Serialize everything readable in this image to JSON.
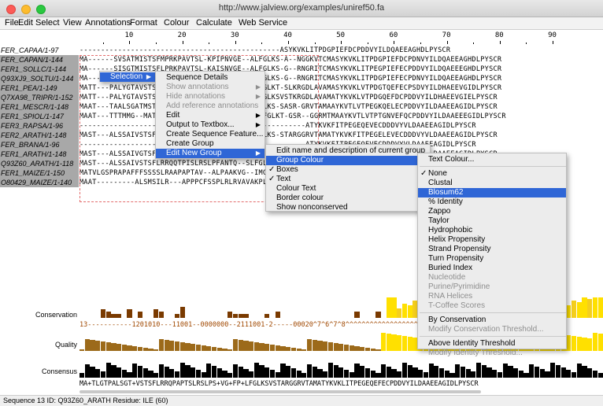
{
  "window": {
    "title": "http://www.jalview.org/examples/uniref50.fa"
  },
  "menubar": [
    "File",
    "Edit",
    "Select",
    "View",
    "Annotations",
    "Format",
    "Colour",
    "Calculate",
    "Web Service"
  ],
  "ruler": [
    "10",
    "20",
    "30",
    "40",
    "50",
    "60",
    "70",
    "80",
    "90"
  ],
  "sequences": [
    {
      "name": "FER_CAPAA/1-97",
      "seq": "-----------------------------------------------ASYKVKLITPDGPIEFDCPDDVYILDQAEEAGHDLPYSCR"
    },
    {
      "name": "FER_CAPAN/1-144",
      "seq": "MA------SVSATMISTSFMPRKPAVTSL-KPIPNVGE--ALFGLKS-A--NGGKVTCMASYKVKLITPDGPIEFDCPDNVYILDQAEEAGHDLPYSCR"
    },
    {
      "name": "FER1_SOLLC/1-144",
      "seq": "MA------SISGTMISTSFLPRKPAVTSL-KAISNVGE--ALFGLKS-G--RNGRITCMASYKVKLITPEGPIEFECPDDVYILDQAEEEGHDLPYSCR"
    },
    {
      "name": "Q93XJ9_SOLTU/1-144",
      "seq": "MA------SISGTMISTSFLPRKPVVTSL-KAISNVGE--ALFGLKS-G--RNGRITCMASYKVKLITPDGPIEFECPDNVYILDQAEEAGHDLPYSCR"
    },
    {
      "name": "FER1_PEA/1-149",
      "seq": "MATT---PALYGTAVSTSFLRTQPMPMSV-TTTKAFSN--GFLGLKT-SLKRGDLAVAMASYKVKLVTPDGTQEFECPSDVYILDHAEEVGIDLPYSCR"
    },
    {
      "name": "Q7XA98_TRIPR/1-152",
      "seq": "MATT---PALYGTAVSTSFMRRQPVPMSV-ATTTTTKAFPSGFGLKSVSTKRGDLAVAMATYKVKLVTPDGQEFDCPDDVYILDHAEEVGIELPYSCR"
    },
    {
      "name": "FER1_MESCR/1-148",
      "seq": "MAAT---TAALSGATMSTAFAPKTPPMTAALPTNVGR--ALFGLKS-SASR-GRVTAMAAYKVTLVTPEGKQELECPDDVYILDAAEEAGIDLPYSCR"
    },
    {
      "name": "FER1_SPIOL/1-147",
      "seq": "MAAT---TTTMMG--MATTFVPKPQAPPMMAALPSNTGR--SLFGLKT-GSR--GGRMTMAAYKVTLVTPTGNVEFQCPDDVYILDAAEEEGIDLPYSCR"
    },
    {
      "name": "FER3_RAPSA/1-96",
      "seq": "-----------------------------------------------------ATYKVKFITPEGEQEVECDDDVYVLDAAEEAGIDLPYSCR"
    },
    {
      "name": "FER2_ARATH/1-148",
      "seq": "MAST---ALSSAIVSTSFLRRQQTPISLRSLPFANTQ--SLFGLKS-STARGGRVTAMATYKVKFITPEGELEVECDDDVYVLDAAEEAGIDLPYSCR"
    },
    {
      "name": "FER_BRANA/1-96",
      "seq": "-----------------------------------------------------ATYKVKFITPEGEQEVECDDDVYVLDAAEEAGIDLPYSCR"
    },
    {
      "name": "FER1_ARATH/1-148",
      "seq": "MAST---ALSSAIVGTSFIRRSPAPISLRSLPSANTQ--SLFGLKS-GTARGGRVTAMATYKVKFITPEGELEVECDDDVYVLDAAEEAGIDLPYSCR"
    },
    {
      "name": "Q93Z60_ARATH/1-118",
      "seq": "MAST---ALSSAIVSTSFLRRQQTPISLRSLPFANTQ--SLFGLKS-STARGGRVTAMATYKVKFITPEGELEVECDDDVYVLDAAEEAGIDLPYSCR"
    },
    {
      "name": "FER1_MAIZE/1-150",
      "seq": "MATVLGSPRAPAFFFSSSSLRAAPAPTAV--ALPAAKVG--IMGRSA-SSRRRLRAQATYNVKLITPEGEVELQVPDDVYILDQAEEDGIDLPYSCR"
    },
    {
      "name": "O80429_MAIZE/1-140",
      "seq": "MAAT---------ALSMSILR---APPPCFSSPLRLRVAVAKPLAA--PMRRQLLRAQATYNVKLITPEGEVELQVPDDVYILDFAEEEGIDLPFSCR"
    }
  ],
  "annotations": {
    "conservation_label": "Conservation",
    "quality_label": "Quality",
    "consensus_label": "Consensus",
    "conservation_text": "13-----------1201010---11001--0000000--2111001-2-----00020^7^6^7^8^^^^^^^^^^^^^^^^^^^^^^^^^^9^9^^^",
    "consensus_text": "MA+TLGTPALSGT+VSTSFLRRQPAPTSLRSLPS+VG+FP+LFGLKSVSTARGGRVTAMATYKVKLITPEGEQEFECPDDVYILDAAEEAGIDLPYSCR"
  },
  "status": "Sequence 13 ID: Q93Z60_ARATH Residue: ILE (60)",
  "menus": {
    "selection_label": "Selection",
    "popup1": [
      {
        "label": "Sequence Details"
      },
      {
        "label": "Show annotations",
        "disabled": true,
        "sub": true
      },
      {
        "label": "Hide annotations",
        "disabled": true,
        "sub": true
      },
      {
        "label": "Add reference annotations",
        "disabled": true
      },
      {
        "label": "Edit",
        "sub": true
      },
      {
        "label": "Output to Textbox...",
        "sub": true
      },
      {
        "label": "Create Sequence Feature..."
      },
      {
        "label": "Create Group"
      },
      {
        "label": "Edit New Group",
        "sub": true,
        "selected": true
      }
    ],
    "popup2": [
      {
        "label": "Edit name and description of current group"
      },
      {
        "label": "Group Colour",
        "sub": true,
        "selected": true
      },
      {
        "label": "Boxes",
        "checked": true
      },
      {
        "label": "Text",
        "checked": true
      },
      {
        "label": "Colour Text"
      },
      {
        "label": "Border colour"
      },
      {
        "label": "Show nonconserved"
      }
    ],
    "popup3": [
      {
        "label": "Text Colour..."
      },
      {
        "label": "None",
        "checked": true
      },
      {
        "label": "Clustal"
      },
      {
        "label": "Blosum62",
        "selected": true
      },
      {
        "label": "% Identity"
      },
      {
        "label": "Zappo"
      },
      {
        "label": "Taylor"
      },
      {
        "label": "Hydrophobic"
      },
      {
        "label": "Helix Propensity"
      },
      {
        "label": "Strand Propensity"
      },
      {
        "label": "Turn Propensity"
      },
      {
        "label": "Buried Index"
      },
      {
        "label": "Nucleotide",
        "disabled": true
      },
      {
        "label": "Purine/Pyrimidine",
        "disabled": true
      },
      {
        "label": "RNA Helices",
        "disabled": true
      },
      {
        "label": "T-Coffee Scores",
        "disabled": true
      },
      {
        "label": "By Conservation"
      },
      {
        "label": "Modify Conservation Threshold...",
        "disabled": true
      },
      {
        "label": "Above Identity Threshold"
      },
      {
        "label": "Modify Identity Threshold...",
        "disabled": true
      }
    ]
  },
  "colors": {
    "selected": "#2f66d6",
    "conservation_low": "#7a3a00",
    "conservation_high": "#ffe000",
    "quality": "#9c6a1a",
    "consensus": "#000000",
    "group_border": "#e36c6c"
  },
  "icons": [
    "close-icon",
    "minimize-icon",
    "zoom-icon",
    "submenu-arrow-icon",
    "checkmark-icon"
  ]
}
